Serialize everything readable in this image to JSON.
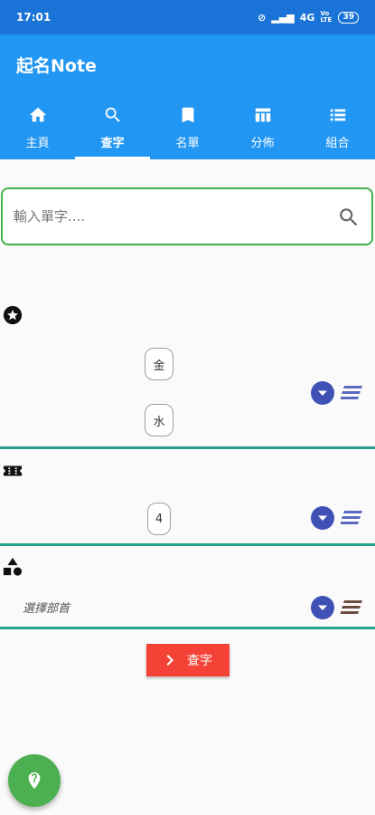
{
  "status_bar": {
    "time": "17:01",
    "network": "4G",
    "volte": "Vo LTE",
    "battery": "39"
  },
  "app": {
    "title": "起名Note"
  },
  "tabs": [
    {
      "label": "主頁",
      "icon": "home-icon"
    },
    {
      "label": "查字",
      "icon": "search-icon",
      "active": true
    },
    {
      "label": "名單",
      "icon": "bookmark-icon"
    },
    {
      "label": "分佈",
      "icon": "table-icon"
    },
    {
      "label": "組合",
      "icon": "list-icon"
    }
  ],
  "search": {
    "placeholder": "輸入單字....",
    "value": ""
  },
  "elements_section": {
    "icon": "star-circle-icon",
    "chips": [
      "金",
      "水"
    ]
  },
  "strokes_section": {
    "icon": "ticket-icon",
    "chips": [
      "4"
    ]
  },
  "radical_section": {
    "icon": "shapes-icon",
    "placeholder": "選擇部首"
  },
  "actions": {
    "search_button": "查字"
  },
  "fab": {
    "icon": "map-marker-question-icon"
  },
  "colors": {
    "app_bar": "#2196f3",
    "status_bar": "#1a73d6",
    "accent": "#3f51b5",
    "divider": "#26a08a",
    "button": "#f44336",
    "fab": "#4caf50",
    "search_border": "#43b14a"
  }
}
